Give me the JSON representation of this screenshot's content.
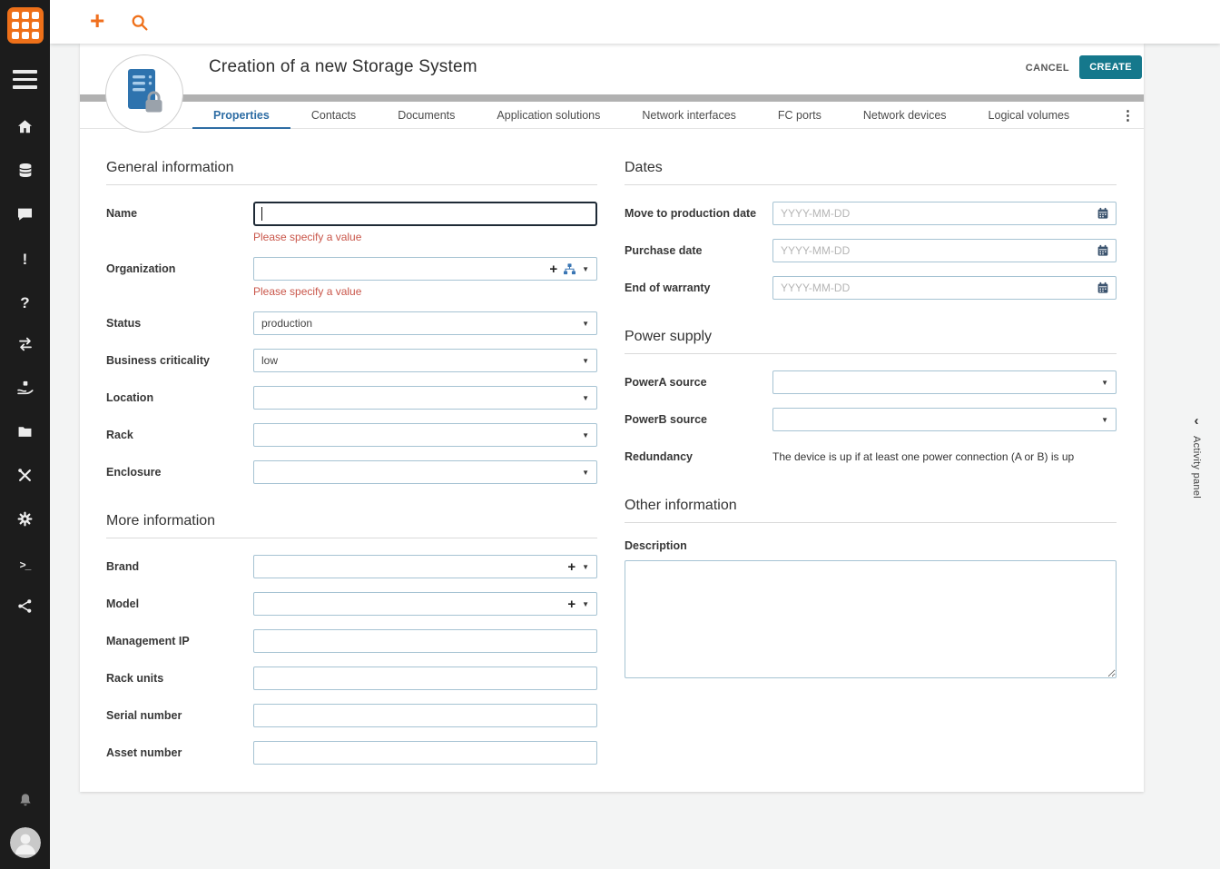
{
  "colors": {
    "orange": "#EE7019",
    "teal_button": "#15788C",
    "active_tab_blue": "#2E6DA4",
    "error_red": "#C9564A",
    "sidebar_bg": "#1C1C1C",
    "header_band_gray": "#B1B1B1"
  },
  "icons": {
    "add": "+",
    "plus_small": "+",
    "caret_down": "▼",
    "more_vertical": "⋮",
    "alert": "!",
    "help": "?",
    "terminal": ">_",
    "chevron_collapse": "‹"
  },
  "sidebar": {
    "icon_names": [
      "home",
      "database",
      "chat",
      "alert",
      "help",
      "transfer",
      "service-management",
      "folder",
      "tools",
      "settings",
      "terminal",
      "share"
    ],
    "bottom_icon_names": [
      "notifications-bell",
      "user-avatar"
    ]
  },
  "header": {
    "title": "Creation of a new Storage System",
    "cancel_label": "CANCEL",
    "create_label": "CREATE"
  },
  "tabs": [
    {
      "label": "Properties",
      "active": true
    },
    {
      "label": "Contacts",
      "active": false
    },
    {
      "label": "Documents",
      "active": false
    },
    {
      "label": "Application solutions",
      "active": false
    },
    {
      "label": "Network interfaces",
      "active": false
    },
    {
      "label": "FC ports",
      "active": false
    },
    {
      "label": "Network devices",
      "active": false
    },
    {
      "label": "Logical volumes",
      "active": false
    }
  ],
  "form": {
    "general": {
      "title": "General information",
      "name": {
        "label": "Name",
        "value": "",
        "error": "Please specify a value"
      },
      "organization": {
        "label": "Organization",
        "value": "",
        "error": "Please specify a value"
      },
      "status": {
        "label": "Status",
        "value": "production"
      },
      "business_criticality": {
        "label": "Business criticality",
        "value": "low"
      },
      "location": {
        "label": "Location",
        "value": ""
      },
      "rack": {
        "label": "Rack",
        "value": ""
      },
      "enclosure": {
        "label": "Enclosure",
        "value": ""
      }
    },
    "more_info": {
      "title": "More information",
      "brand": {
        "label": "Brand",
        "value": ""
      },
      "model": {
        "label": "Model",
        "value": ""
      },
      "management_ip": {
        "label": "Management IP",
        "value": ""
      },
      "rack_units": {
        "label": "Rack units",
        "value": ""
      },
      "serial_number": {
        "label": "Serial number",
        "value": ""
      },
      "asset_number": {
        "label": "Asset number",
        "value": ""
      }
    },
    "dates": {
      "title": "Dates",
      "placeholder": "YYYY-MM-DD",
      "move_to_production": {
        "label": "Move to production date",
        "value": ""
      },
      "purchase_date": {
        "label": "Purchase date",
        "value": ""
      },
      "end_of_warranty": {
        "label": "End of warranty",
        "value": ""
      }
    },
    "power_supply": {
      "title": "Power supply",
      "power_a": {
        "label": "PowerA source",
        "value": ""
      },
      "power_b": {
        "label": "PowerB source",
        "value": ""
      },
      "redundancy": {
        "label": "Redundancy",
        "text": "The device is up if at least one power connection (A or B) is up"
      }
    },
    "other": {
      "title": "Other information",
      "description": {
        "label": "Description",
        "value": ""
      }
    }
  },
  "activity_panel": {
    "label": "Activity panel"
  }
}
